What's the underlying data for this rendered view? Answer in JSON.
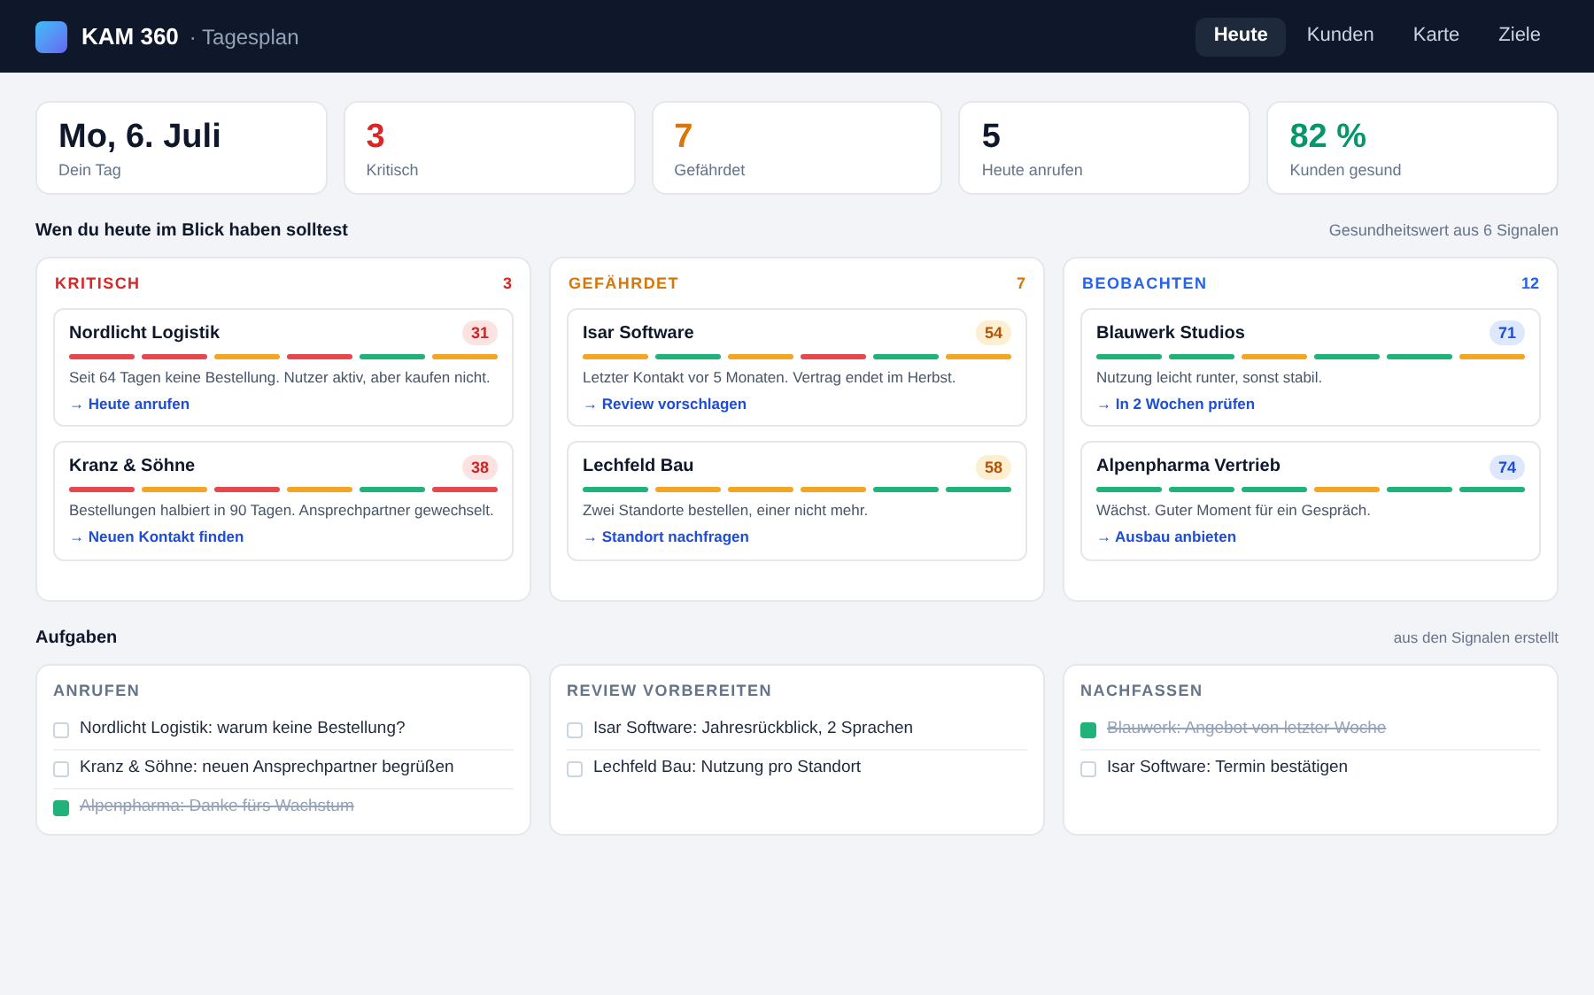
{
  "header": {
    "brand": "KAM 360",
    "subtitle": "· Tagesplan",
    "nav": [
      {
        "label": "Heute",
        "selected": true
      },
      {
        "label": "Kunden",
        "selected": false
      },
      {
        "label": "Karte",
        "selected": false
      },
      {
        "label": "Ziele",
        "selected": false
      }
    ]
  },
  "stats": [
    {
      "value": "Mo, 6. Juli",
      "label": "Dein Tag",
      "kind": "neutral"
    },
    {
      "value": "3",
      "label": "Kritisch",
      "kind": "critical"
    },
    {
      "value": "7",
      "label": "Gefährdet",
      "kind": "risk"
    },
    {
      "value": "5",
      "label": "Heute anrufen",
      "kind": "neutral"
    },
    {
      "value": "82 %",
      "label": "Kunden gesund",
      "kind": "good"
    }
  ],
  "focus": {
    "title": "Wen du heute im Blick haben solltest",
    "note": "Gesundheitswert aus 6 Signalen",
    "columns": [
      {
        "title": "KRITISCH",
        "count": "3",
        "kind": "critical",
        "accounts": [
          {
            "name": "Nordlicht Logistik",
            "score": "31",
            "signals": [
              {
                "color": "#e5484d"
              },
              {
                "color": "#e5484d"
              },
              {
                "color": "#f5a524"
              },
              {
                "color": "#e5484d"
              },
              {
                "color": "#1fb37a"
              },
              {
                "color": "#f5a524"
              }
            ],
            "text": "Seit 64 Tagen keine Bestellung. Nutzer aktiv, aber kaufen nicht.",
            "action": "→ Heute anrufen"
          },
          {
            "name": "Kranz & Söhne",
            "score": "38",
            "signals": [
              {
                "color": "#e5484d"
              },
              {
                "color": "#f5a524"
              },
              {
                "color": "#e5484d"
              },
              {
                "color": "#f5a524"
              },
              {
                "color": "#1fb37a"
              },
              {
                "color": "#e5484d"
              }
            ],
            "text": "Bestellungen halbiert in 90 Tagen. Ansprechpartner gewechselt.",
            "action": "→ Neuen Kontakt finden"
          }
        ]
      },
      {
        "title": "GEFÄHRDET",
        "count": "7",
        "kind": "risk",
        "accounts": [
          {
            "name": "Isar Software",
            "score": "54",
            "signals": [
              {
                "color": "#f5a524"
              },
              {
                "color": "#1fb37a"
              },
              {
                "color": "#f5a524"
              },
              {
                "color": "#e5484d"
              },
              {
                "color": "#1fb37a"
              },
              {
                "color": "#f5a524"
              }
            ],
            "text": "Letzter Kontakt vor 5 Monaten. Vertrag endet im Herbst.",
            "action": "→ Review vorschlagen"
          },
          {
            "name": "Lechfeld Bau",
            "score": "58",
            "signals": [
              {
                "color": "#1fb37a"
              },
              {
                "color": "#f5a524"
              },
              {
                "color": "#f5a524"
              },
              {
                "color": "#f5a524"
              },
              {
                "color": "#1fb37a"
              },
              {
                "color": "#1fb37a"
              }
            ],
            "text": "Zwei Standorte bestellen, einer nicht mehr.",
            "action": "→ Standort nachfragen"
          }
        ]
      },
      {
        "title": "BEOBACHTEN",
        "count": "12",
        "kind": "watch",
        "accounts": [
          {
            "name": "Blauwerk Studios",
            "score": "71",
            "signals": [
              {
                "color": "#1fb37a"
              },
              {
                "color": "#1fb37a"
              },
              {
                "color": "#f5a524"
              },
              {
                "color": "#1fb37a"
              },
              {
                "color": "#1fb37a"
              },
              {
                "color": "#f5a524"
              }
            ],
            "text": "Nutzung leicht runter, sonst stabil.",
            "action": "→ In 2 Wochen prüfen"
          },
          {
            "name": "Alpenpharma Vertrieb",
            "score": "74",
            "signals": [
              {
                "color": "#1fb37a"
              },
              {
                "color": "#1fb37a"
              },
              {
                "color": "#1fb37a"
              },
              {
                "color": "#f5a524"
              },
              {
                "color": "#1fb37a"
              },
              {
                "color": "#1fb37a"
              }
            ],
            "text": "Wächst. Guter Moment für ein Gespräch.",
            "action": "→ Ausbau anbieten"
          }
        ]
      }
    ]
  },
  "tasks": {
    "title": "Aufgaben",
    "note": "aus den Signalen erstellt",
    "groups": [
      {
        "title": "ANRUFEN",
        "items": [
          {
            "text": "Nordlicht Logistik: warum keine Bestellung?",
            "checked": false
          },
          {
            "text": "Kranz & Söhne: neuen Ansprechpartner begrüßen",
            "checked": false
          },
          {
            "text": "Alpenpharma: Danke fürs Wachstum",
            "checked": true
          }
        ]
      },
      {
        "title": "REVIEW VORBEREITEN",
        "items": [
          {
            "text": "Isar Software: Jahresrückblick, 2 Sprachen",
            "checked": false
          },
          {
            "text": "Lechfeld Bau: Nutzung pro Standort",
            "checked": false
          }
        ]
      },
      {
        "title": "NACHFASSEN",
        "items": [
          {
            "text": "Blauwerk: Angebot von letzter Woche",
            "checked": true
          },
          {
            "text": "Isar Software: Termin bestätigen",
            "checked": false
          }
        ]
      }
    ]
  }
}
